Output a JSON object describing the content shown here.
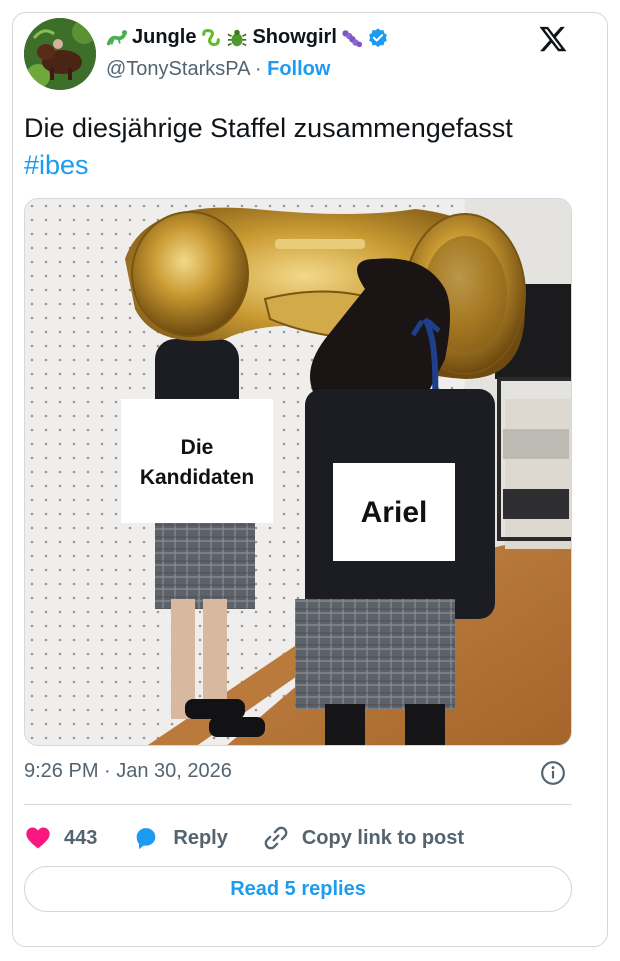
{
  "author": {
    "name_parts": [
      "Jungle",
      "Showgirl"
    ],
    "handle": "@TonyStarksPA",
    "separator": "·",
    "follow_label": "Follow",
    "verified": true,
    "brand_color": "#1d9bf0"
  },
  "tweet": {
    "text": "Die diesjährige Staffel zusammengefasst",
    "hashtag": "#ibes"
  },
  "media": {
    "label_left_line1": "Die",
    "label_left_line2": "Kandidaten",
    "label_right": "Ariel"
  },
  "meta": {
    "timestamp": "9:26 PM · Jan 30, 2026"
  },
  "actions": {
    "like_count": "443",
    "reply_label": "Reply",
    "copy_label": "Copy link to post",
    "like_color": "#f91880"
  },
  "footer": {
    "read_replies_label": "Read 5 replies"
  },
  "icons": [
    "lizard-icon",
    "snake-icon",
    "beetle-icon",
    "caterpillar-icon",
    "verified-badge-icon",
    "x-logo-icon",
    "info-icon",
    "heart-icon",
    "reply-icon",
    "link-icon"
  ]
}
